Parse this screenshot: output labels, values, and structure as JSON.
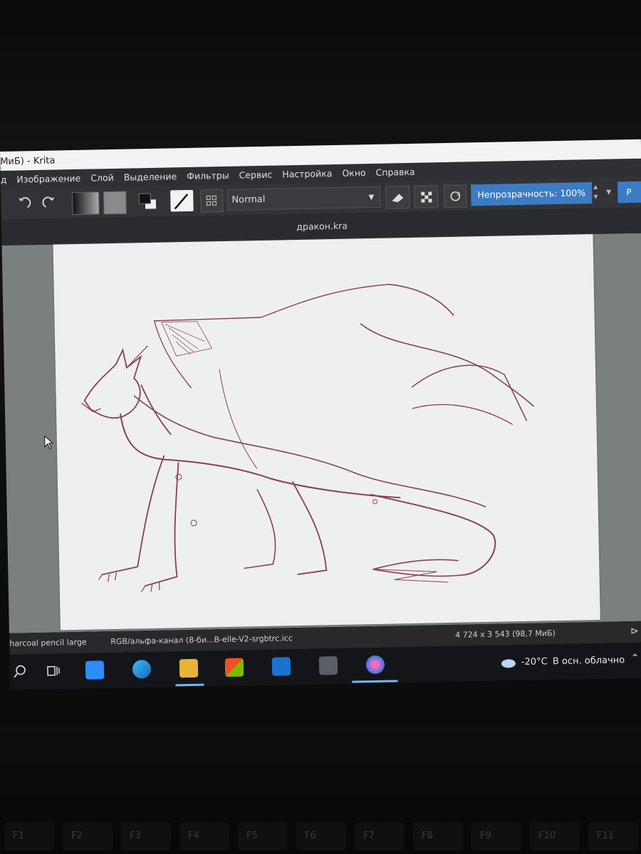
{
  "window": {
    "title": "МиБ) - Krita"
  },
  "menu": [
    "д",
    "Изображение",
    "Слой",
    "Выделение",
    "Фильтры",
    "Сервис",
    "Настройка",
    "Окно",
    "Справка"
  ],
  "toolbar": {
    "blend_mode": "Normal",
    "opacity_label": "Непрозрачность: 100%",
    "right_button": "Р"
  },
  "document": {
    "tab_name": "дракон.kra"
  },
  "status": {
    "brush_preset": "harcoal pencil large",
    "color_profile": "RGB/альфа-канал (8-би...B-elle-V2-srgbtrc.icc",
    "image_size": "4 724 x 3 543 (98,7 МиБ)"
  },
  "taskbar": {
    "weather_temp": "-20°C",
    "weather_desc": "В осн. облачно"
  },
  "keyboard": {
    "fkeys": [
      "F1",
      "F2",
      "F3",
      "F4",
      "F5",
      "F6",
      "F7",
      "F8",
      "F9",
      "F10",
      "F11"
    ]
  },
  "colors": {
    "sketch_stroke": "#7a1f3d",
    "opacity_button": "#3b7cc4",
    "canvas_bg": "#eef0ef"
  }
}
